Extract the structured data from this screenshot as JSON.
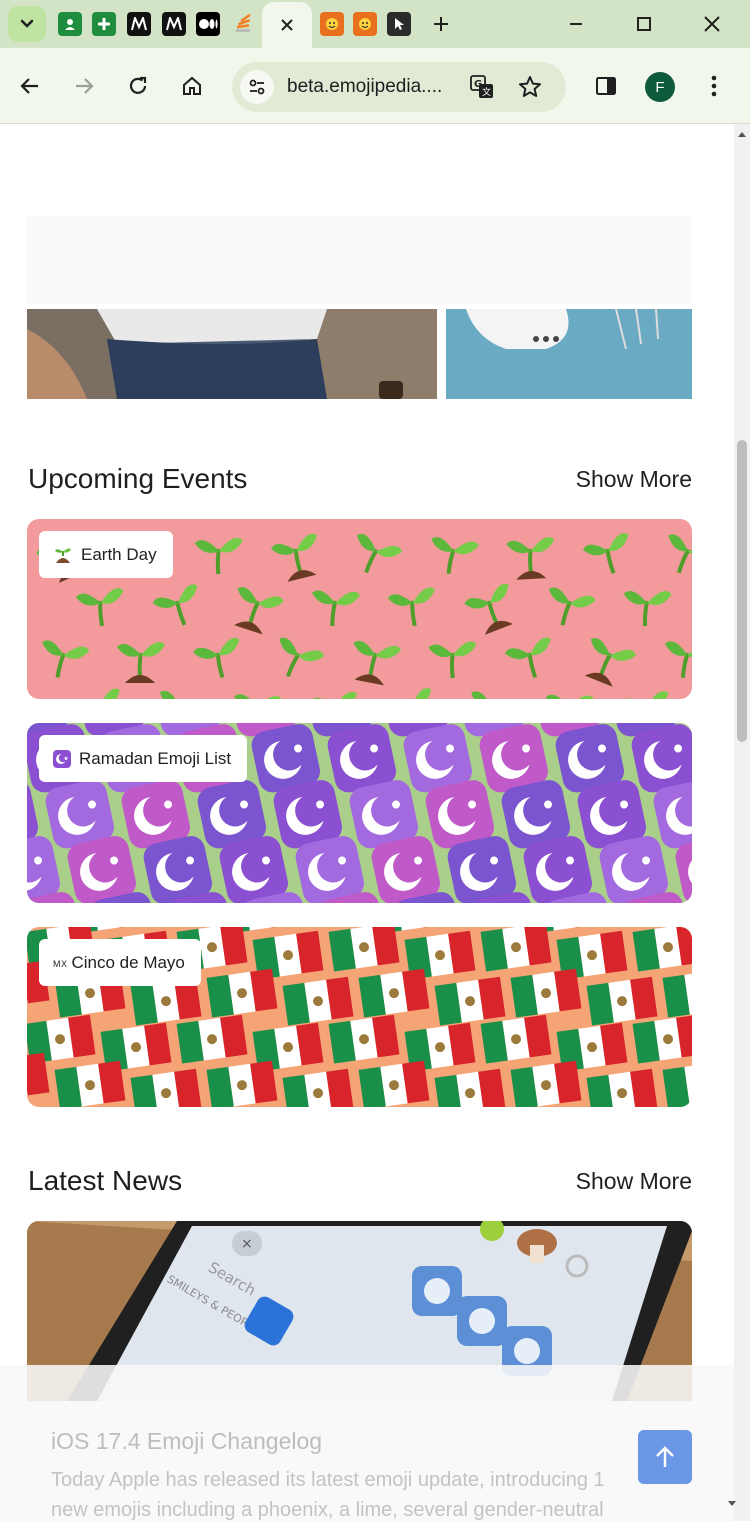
{
  "browser": {
    "tabs": [
      {
        "name": "contacts-tab",
        "icon": "contacts-icon",
        "color": "#1e8e3e"
      },
      {
        "name": "plus-tab",
        "icon": "plus-box-icon",
        "color": "#1e8e3e"
      },
      {
        "name": "medium-tab-1",
        "icon": "medium-m-icon",
        "color": "#111111"
      },
      {
        "name": "medium-tab-2",
        "icon": "medium-m-icon",
        "color": "#111111"
      },
      {
        "name": "medium-tab-3",
        "icon": "medium-dots-icon",
        "color": "#000000"
      },
      {
        "name": "stack-tab",
        "icon": "stack-icon",
        "color": "#f48024"
      },
      {
        "name": "emojipedia-tab-active",
        "icon": "close-icon",
        "active": true
      },
      {
        "name": "emojipedia-tab-2",
        "icon": "emojipedia-logo-icon",
        "color": "#e86f1c"
      },
      {
        "name": "emojipedia-tab-3",
        "icon": "emojipedia-logo-icon",
        "color": "#e86f1c"
      },
      {
        "name": "cursor-tab",
        "icon": "cursor-icon",
        "color": "#2b2b2b"
      }
    ],
    "url": "beta.emojipedia....",
    "profile_initial": "F"
  },
  "events": {
    "heading": "Upcoming Events",
    "show_more": "Show More",
    "items": [
      {
        "label": "Earth Day",
        "icon": "seedling-icon",
        "bg": "#f29a9c"
      },
      {
        "label": "Ramadan Emoji List",
        "icon": "crescent-star-icon",
        "bg": "#a9cf8a"
      },
      {
        "label": "Cinco de Mayo",
        "prefix": "MX",
        "icon": "mexico-flag-icon",
        "bg": "#f5a476"
      }
    ]
  },
  "news": {
    "heading": "Latest News",
    "show_more": "Show More",
    "items": [
      {
        "title": "iOS 17.4 Emoji Changelog",
        "excerpt_line1": "Today Apple has released its latest emoji update, introducing 1",
        "excerpt_line2": "new emojis including a phoenix, a lime, several gender-neutral",
        "image_search": "Search",
        "image_category": "SMILEYS & PEOPLE"
      }
    ]
  },
  "colors": {
    "accent": "#6a97e6",
    "header_bg": "#eef1f7",
    "browser_chrome": "#d3e3c5"
  }
}
